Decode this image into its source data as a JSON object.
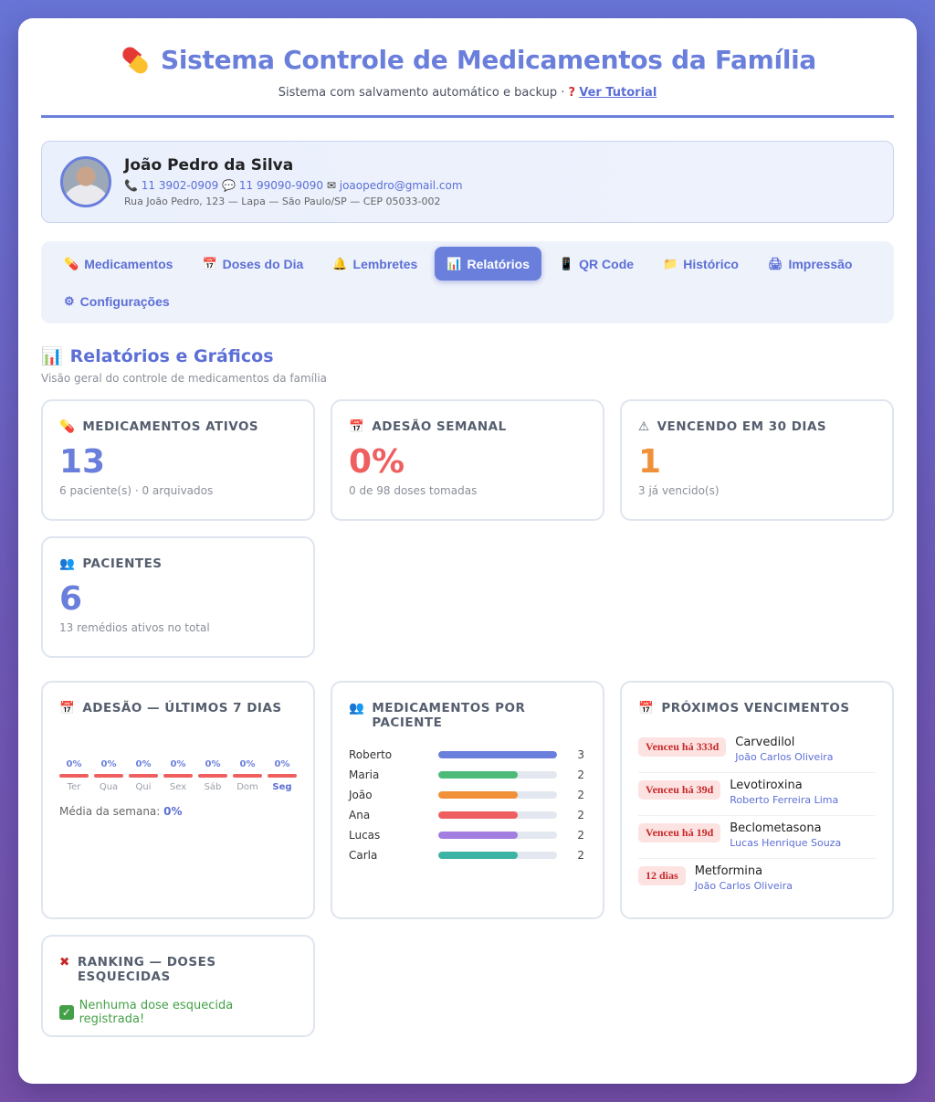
{
  "header": {
    "title": "Sistema Controle de Medicamentos da Família",
    "subtitle": "Sistema com salvamento automático e backup ·",
    "tutorial_link": "Ver Tutorial"
  },
  "profile": {
    "name": "João Pedro da Silva",
    "phone": "11 3902-0909",
    "whatsapp": "11 99090-9090",
    "email": "joaopedro@gmail.com",
    "address": "Rua João Pedro, 123 — Lapa — São Paulo/SP — CEP 05033-002"
  },
  "tabs": [
    {
      "label": "Medicamentos",
      "icon": "💊"
    },
    {
      "label": "Doses do Dia",
      "icon": "📅"
    },
    {
      "label": "Lembretes",
      "icon": "🔔"
    },
    {
      "label": "Relatórios",
      "icon": "📊",
      "active": true
    },
    {
      "label": "QR Code",
      "icon": "📱"
    },
    {
      "label": "Histórico",
      "icon": "📁"
    },
    {
      "label": "Impressão",
      "icon": "🖨"
    },
    {
      "label": "Configurações",
      "icon": "⚙"
    }
  ],
  "section": {
    "title": "Relatórios e Gráficos",
    "subtitle": "Visão geral do controle de medicamentos da família"
  },
  "stats": {
    "ativos": {
      "label": "MEDICAMENTOS ATIVOS",
      "value": "13",
      "note": "6 paciente(s) · 0 arquivados"
    },
    "adesao": {
      "label": "ADESÃO SEMANAL",
      "value": "0%",
      "note": "0 de 98 doses tomadas"
    },
    "vencendo": {
      "label": "VENCENDO EM 30 DIAS",
      "value": "1",
      "note": "3 já vencido(s)"
    },
    "pacientes": {
      "label": "PACIENTES",
      "value": "6",
      "note": "13 remédios ativos no total"
    }
  },
  "adesao7": {
    "title": "ADESÃO — ÚLTIMOS 7 DIAS",
    "days": [
      {
        "label": "Ter",
        "pct": "0%"
      },
      {
        "label": "Qua",
        "pct": "0%"
      },
      {
        "label": "Qui",
        "pct": "0%"
      },
      {
        "label": "Sex",
        "pct": "0%"
      },
      {
        "label": "Sáb",
        "pct": "0%"
      },
      {
        "label": "Dom",
        "pct": "0%"
      },
      {
        "label": "Seg",
        "pct": "0%"
      }
    ],
    "avg_label": "Média da semana:",
    "avg_value": "0%"
  },
  "por_paciente": {
    "title": "MEDICAMENTOS POR PACIENTE",
    "rows": [
      {
        "name": "Roberto",
        "count": "3",
        "fraction": 1.0,
        "color": "#6a7fdb"
      },
      {
        "name": "Maria",
        "count": "2",
        "fraction": 0.667,
        "color": "#4cbb7a"
      },
      {
        "name": "João",
        "count": "2",
        "fraction": 0.667,
        "color": "#f0913a"
      },
      {
        "name": "Ana",
        "count": "2",
        "fraction": 0.667,
        "color": "#ef5f5f"
      },
      {
        "name": "Lucas",
        "count": "2",
        "fraction": 0.667,
        "color": "#a27ee0"
      },
      {
        "name": "Carla",
        "count": "2",
        "fraction": 0.667,
        "color": "#3db3a4"
      }
    ]
  },
  "vencimentos": {
    "title": "PRÓXIMOS VENCIMENTOS",
    "rows": [
      {
        "badge": "Venceu há 333d",
        "med": "Carvedilol",
        "patient": "João Carlos Oliveira"
      },
      {
        "badge": "Venceu há 39d",
        "med": "Levotiroxina",
        "patient": "Roberto Ferreira Lima"
      },
      {
        "badge": "Venceu há 19d",
        "med": "Beclometasona",
        "patient": "Lucas Henrique Souza"
      },
      {
        "badge": "12 dias",
        "med": "Metformina",
        "patient": "João Carlos Oliveira"
      }
    ]
  },
  "ranking": {
    "title": "RANKING — DOSES ESQUECIDAS",
    "empty": "Nenhuma dose esquecida registrada!"
  }
}
